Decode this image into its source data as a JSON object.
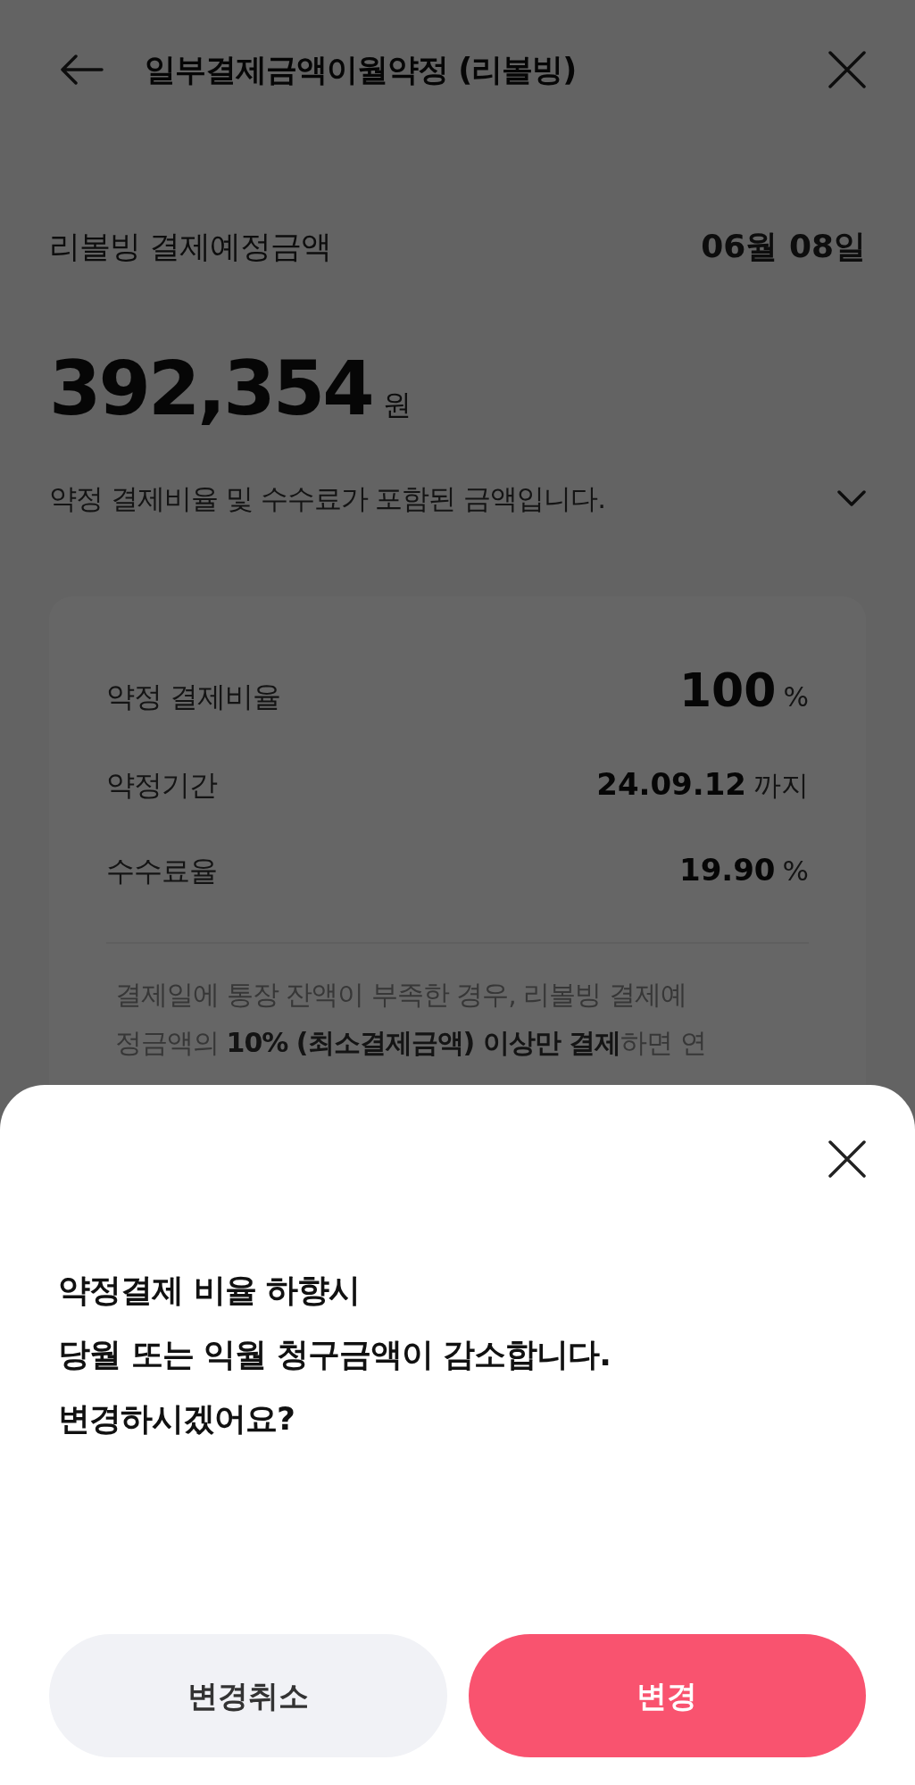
{
  "header": {
    "title": "일부결제금액이월약정 (리볼빙)"
  },
  "summary": {
    "label": "리볼빙 결제예정금액",
    "date": "06월 08일",
    "amount": "392,354",
    "unit": "원",
    "note": "약정 결제비율 및 수수료가 포함된 금액입니다."
  },
  "details": [
    {
      "label": "약정 결제비율",
      "value": "100",
      "unit": "%",
      "kind": "large"
    },
    {
      "label": "약정기간",
      "value": "24.09.12",
      "unit": "까지",
      "kind": "normal"
    },
    {
      "label": "수수료율",
      "value": "19.90",
      "unit": "%",
      "kind": "normal"
    }
  ],
  "notice": "결제일에 통장 잔액이 부족한 경우, 리볼빙 결제예\n정금액의 **10% (최소결제금액) 이상만 결제**하면 연",
  "dialog": {
    "message_lines": [
      "약정결제 비율 하향시",
      "당월 또는 익월 청구금액이 감소합니다.",
      "변경하시겠어요?"
    ],
    "buttons": [
      {
        "label": "변경취소",
        "kind": "secondary"
      },
      {
        "label": "변경",
        "kind": "primary"
      }
    ]
  }
}
